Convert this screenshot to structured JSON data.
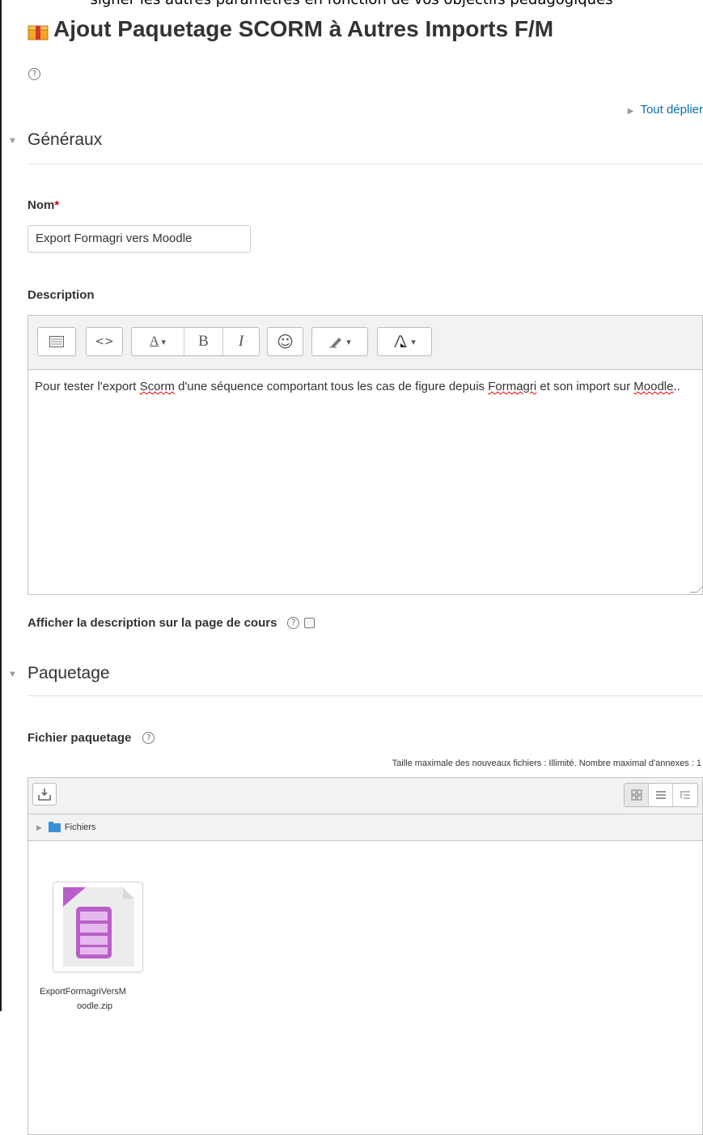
{
  "top_caption": "signer les autres paramètres en fonction de vos objectifs pédagogiques",
  "page": {
    "title": "Ajout Paquetage SCORM à Autres Imports F/M",
    "help": "?",
    "expand_all": "Tout déplier"
  },
  "sections": {
    "general": {
      "title": "Généraux"
    },
    "package": {
      "title": "Paquetage"
    }
  },
  "form": {
    "name_label": "Nom",
    "required_mark": "*",
    "name_value": "Export Formagri vers Moodle",
    "description_label": "Description",
    "description_text": {
      "p1": "Pour tester l'export ",
      "w1": "Scorm",
      "p2": " d'une séquence comportant tous les cas de figure depuis ",
      "w2": "Formagri",
      "p3": " et son import sur ",
      "w3": "Moodle",
      "p4": ".."
    },
    "show_description_label": "Afficher la description sur la page de cours",
    "show_description_checked": false,
    "package_file_label": "Fichier paquetage"
  },
  "editor_toolbar": {
    "toggle_icon": "keyboard-toggle-icon",
    "html_icon": "html-code-icon",
    "style_label": "A",
    "bold": "B",
    "italic": "I",
    "emoticon": "☺",
    "eraser_icon": "clear-formatting-icon",
    "color_icon": "text-color-icon",
    "dropdown": "▾"
  },
  "filepicker": {
    "limits_note": "Taille maximale des nouveaux fichiers : Illimité. Nombre maximal d'annexes : 1",
    "path_label": "Fichiers",
    "file_name": "ExportFormagriVersM",
    "file_name_cont": "oodle.zip"
  },
  "colors": {
    "link": "#0a6fb4",
    "required": "#cc0000",
    "folder": "#3a8fd6",
    "scorm_purple": "#b85fc8"
  }
}
